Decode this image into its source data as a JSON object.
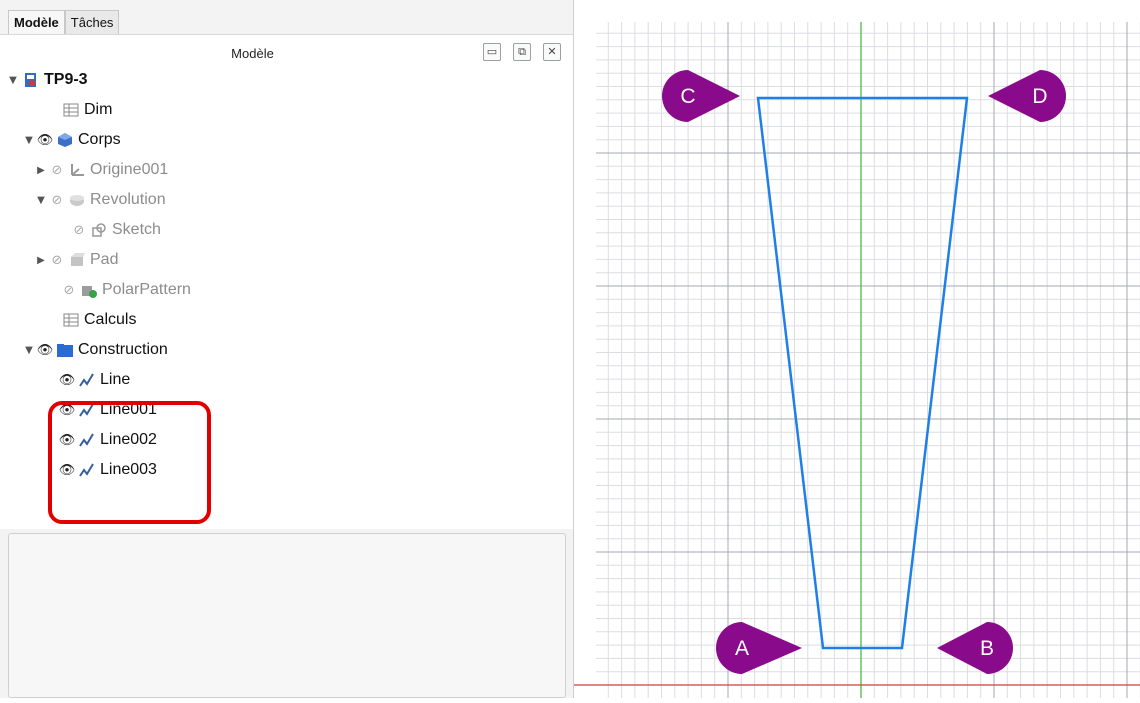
{
  "tabs": [
    {
      "label": "Modèle",
      "active": true
    },
    {
      "label": "Tâches",
      "active": false
    }
  ],
  "panel": {
    "title": "Modèle",
    "buttons": [
      "▭",
      "⧉",
      "✕"
    ]
  },
  "tree": [
    {
      "label": "TP9-3",
      "icon": "document-icon",
      "expander": "expanded",
      "eye": "none",
      "bold": true,
      "dimmed": false
    },
    {
      "label": "Dim",
      "icon": "spreadsheet-icon",
      "expander": "none",
      "eye": "none",
      "bold": false,
      "dimmed": false
    },
    {
      "label": "Corps",
      "icon": "body-icon",
      "expander": "expanded",
      "eye": "visible",
      "bold": false,
      "dimmed": false
    },
    {
      "label": "Origine001",
      "icon": "origin-icon",
      "expander": "collapsed",
      "eye": "hidden",
      "bold": false,
      "dimmed": true
    },
    {
      "label": "Revolution",
      "icon": "revolution-icon",
      "expander": "expanded",
      "eye": "hidden",
      "bold": false,
      "dimmed": true
    },
    {
      "label": "Sketch",
      "icon": "sketch-icon",
      "expander": "none",
      "eye": "hidden",
      "bold": false,
      "dimmed": true
    },
    {
      "label": "Pad",
      "icon": "pad-icon",
      "expander": "collapsed",
      "eye": "hidden",
      "bold": false,
      "dimmed": true
    },
    {
      "label": "PolarPattern",
      "icon": "polar-pattern-icon",
      "expander": "none",
      "eye": "hidden",
      "bold": false,
      "dimmed": true
    },
    {
      "label": "Calculs",
      "icon": "spreadsheet-icon",
      "expander": "none",
      "eye": "none",
      "bold": false,
      "dimmed": false
    },
    {
      "label": "Construction",
      "icon": "folder-icon",
      "expander": "expanded",
      "eye": "visible",
      "bold": false,
      "dimmed": false
    },
    {
      "label": "Line",
      "icon": "line-icon",
      "expander": "none",
      "eye": "visible",
      "bold": false,
      "dimmed": false
    },
    {
      "label": "Line001",
      "icon": "line-icon",
      "expander": "none",
      "eye": "visible",
      "bold": false,
      "dimmed": false
    },
    {
      "label": "Line002",
      "icon": "line-icon",
      "expander": "none",
      "eye": "visible",
      "bold": false,
      "dimmed": false
    },
    {
      "label": "Line003",
      "icon": "line-icon",
      "expander": "none",
      "eye": "visible",
      "bold": false,
      "dimmed": false
    }
  ],
  "viewport": {
    "callouts": [
      "A",
      "B",
      "C",
      "D"
    ]
  },
  "colors": {
    "shape_outline": "#1e7fe8",
    "callout_fill": "#8a0a8c",
    "highlight_border": "#e00000",
    "y_axis": "#3cb83c",
    "x_axis": "#d43c3c"
  }
}
